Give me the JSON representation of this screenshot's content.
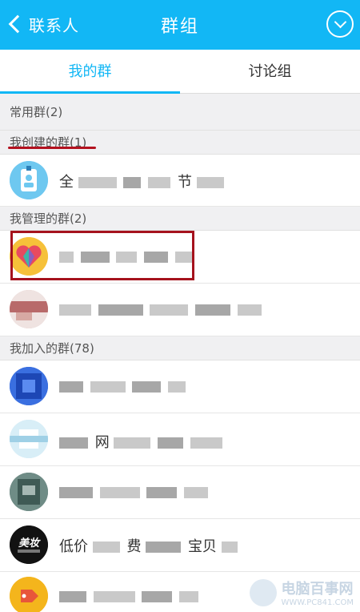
{
  "header": {
    "back_label": "联系人",
    "title": "群组"
  },
  "tabs": [
    {
      "label": "我的群"
    },
    {
      "label": "讨论组"
    }
  ],
  "sections": {
    "common": "常用群(2)",
    "created": "我创建的群(1)",
    "managed": "我管理的群(2)",
    "joined": "我加入的群(78)"
  },
  "groups": {
    "created_name_char1": "全",
    "created_name_char2": "节",
    "joined_3_char1": "网",
    "joined_5_text1": "低价",
    "joined_5_text2": "费",
    "joined_5_text3": "宝贝"
  },
  "avatar_texts": {
    "dark_badge": "美妆"
  },
  "watermark": {
    "title": "电脑百事网",
    "url": "WWW.PC841.COM"
  },
  "colors": {
    "accent": "#12b7f5",
    "highlight": "#a5121d"
  }
}
